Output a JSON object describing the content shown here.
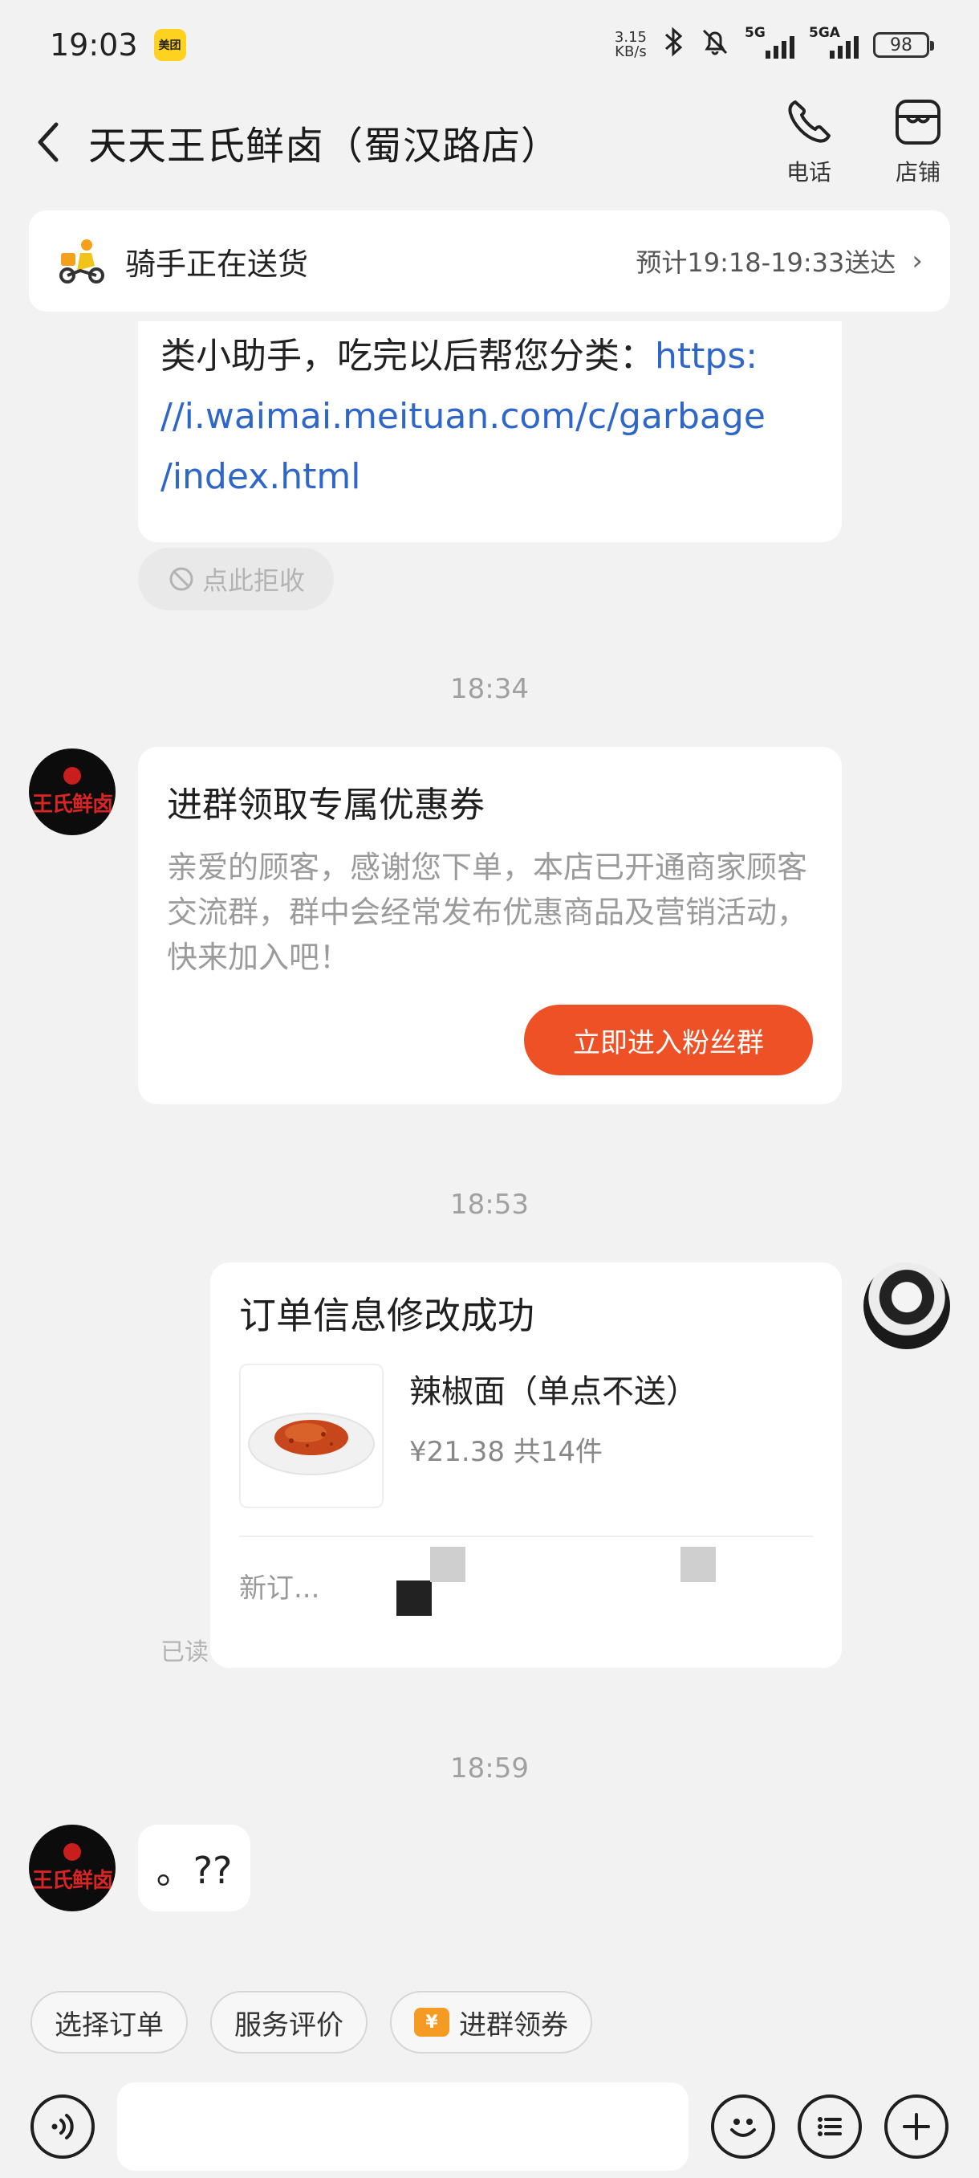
{
  "status_bar": {
    "time": "19:03",
    "app_badge": "美团",
    "net_speed_value": "3.15",
    "net_speed_unit": "KB/s",
    "sim1": "5G",
    "sim2": "5GA",
    "battery": "98"
  },
  "header": {
    "title": "天天王氏鲜卤（蜀汉路店）",
    "actions": [
      {
        "label": "电话",
        "icon": "phone-icon"
      },
      {
        "label": "店铺",
        "icon": "store-icon"
      }
    ]
  },
  "delivery_banner": {
    "status": "骑手正在送货",
    "eta": "预计19:18-19:33送达"
  },
  "messages": {
    "link_message": {
      "text_prefix": "类小助手，吃完以后帮您分类：",
      "link": "https://i.waimai.meituan.com/c/garbage/index.html",
      "link_line1": "https:",
      "link_line2": "//i.waimai.meituan.com/c/garbage",
      "link_line3": "/index.html"
    },
    "reject_chip": "点此拒收",
    "time_1": "18:34",
    "shop_avatar_text": "王氏鲜卤",
    "group_card": {
      "title": "进群领取专属优惠券",
      "body": "亲爱的顾客，感谢您下单，本店已开通商家顾客交流群，群中会经常发布优惠商品及营销活动，快来加入吧！",
      "button": "立即进入粉丝群"
    },
    "time_2": "18:53",
    "order_card": {
      "title": "订单信息修改成功",
      "item_name": "辣椒面（单点不送）",
      "item_price": "¥21.38 共14件",
      "footer": "新订..."
    },
    "read_status": "已读",
    "time_3": "18:59",
    "last_message": "。??"
  },
  "quick_actions": [
    {
      "label": "选择订单"
    },
    {
      "label": "服务评价"
    },
    {
      "label": "进群领券",
      "icon": "coupon-icon"
    }
  ],
  "input": {
    "placeholder": ""
  }
}
